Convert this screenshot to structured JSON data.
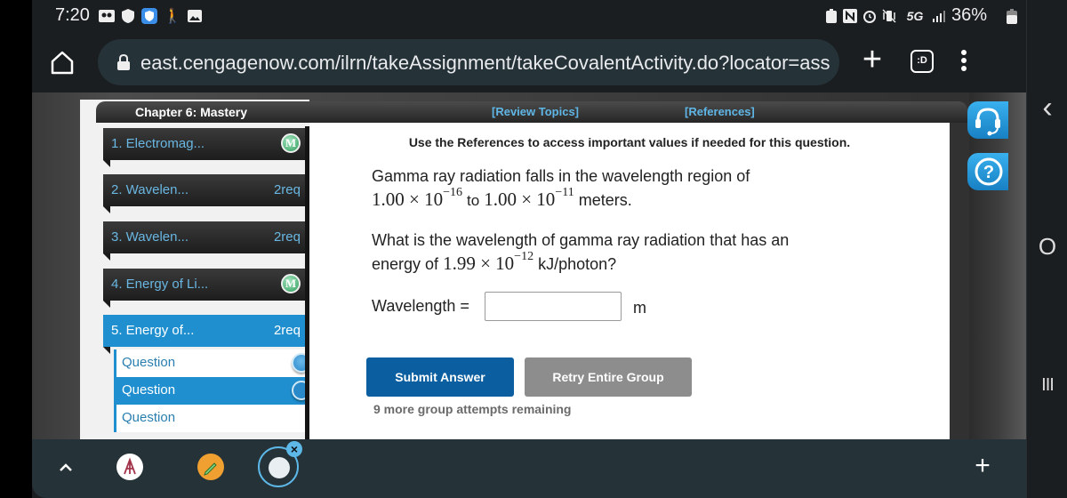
{
  "status_bar": {
    "time": "7:20",
    "left_icons": [
      "voicemail-icon",
      "shield-icon",
      "blue-shield-icon",
      "walking-person-icon",
      "image-icon"
    ],
    "right_icons": [
      "battery-saver-icon",
      "nfc-icon",
      "alarm-icon",
      "vibrate-icon",
      "5g-icon",
      "signal-icon"
    ],
    "network": "5G",
    "battery": "36%"
  },
  "browser": {
    "url": "east.cengagenow.com/ilrn/takeAssignment/takeCovalentActivity.do?locator=ass",
    "tabs_label": ":D"
  },
  "assignment": {
    "chapter_title": "Chapter 6: Mastery",
    "review_topics": "[Review Topics]",
    "references": "[References]",
    "items": [
      {
        "label": "1. Electromag...",
        "badge": "M",
        "badge_type": "mastery"
      },
      {
        "label": "2. Wavelen...",
        "badge": "2req",
        "badge_type": "text"
      },
      {
        "label": "3. Wavelen...",
        "badge": "2req",
        "badge_type": "text"
      },
      {
        "label": "4. Energy of Li...",
        "badge": "M",
        "badge_type": "mastery"
      },
      {
        "label": "5. Energy of...",
        "badge": "2req",
        "badge_type": "text",
        "active": true
      }
    ],
    "sub_questions": [
      {
        "label": "Question",
        "active": false
      },
      {
        "label": "Question",
        "active": true
      },
      {
        "label": "Question",
        "active": false
      }
    ]
  },
  "question": {
    "references_note": "Use the References to access important values if needed for this question.",
    "intro_line1": "Gamma ray radiation falls in the wavelength region of",
    "range_low_mantissa": "1.00 × 10",
    "range_low_exp": "−16",
    "range_to": "to",
    "range_high_mantissa": "1.00 × 10",
    "range_high_exp": "−11",
    "range_unit": "meters.",
    "prompt_line1": "What is the wavelength of gamma ray radiation that has an",
    "prompt_energy_prefix": "energy of",
    "energy_mantissa": "1.99 × 10",
    "energy_exp": "−12",
    "energy_unit": "kJ/photon?",
    "answer_label": "Wavelength =",
    "answer_value": "",
    "answer_unit": "m",
    "submit_label": "Submit Answer",
    "retry_label": "Retry Entire Group",
    "attempts_text": "9 more group attempts remaining"
  },
  "side_tools": [
    "headset-icon",
    "help-icon"
  ],
  "nav": {
    "back": "‹",
    "home": "O",
    "recents": "III",
    "plus": "+"
  },
  "dock": {
    "apps": [
      "university-app",
      "notes-app",
      "edge-panel-app"
    ]
  }
}
